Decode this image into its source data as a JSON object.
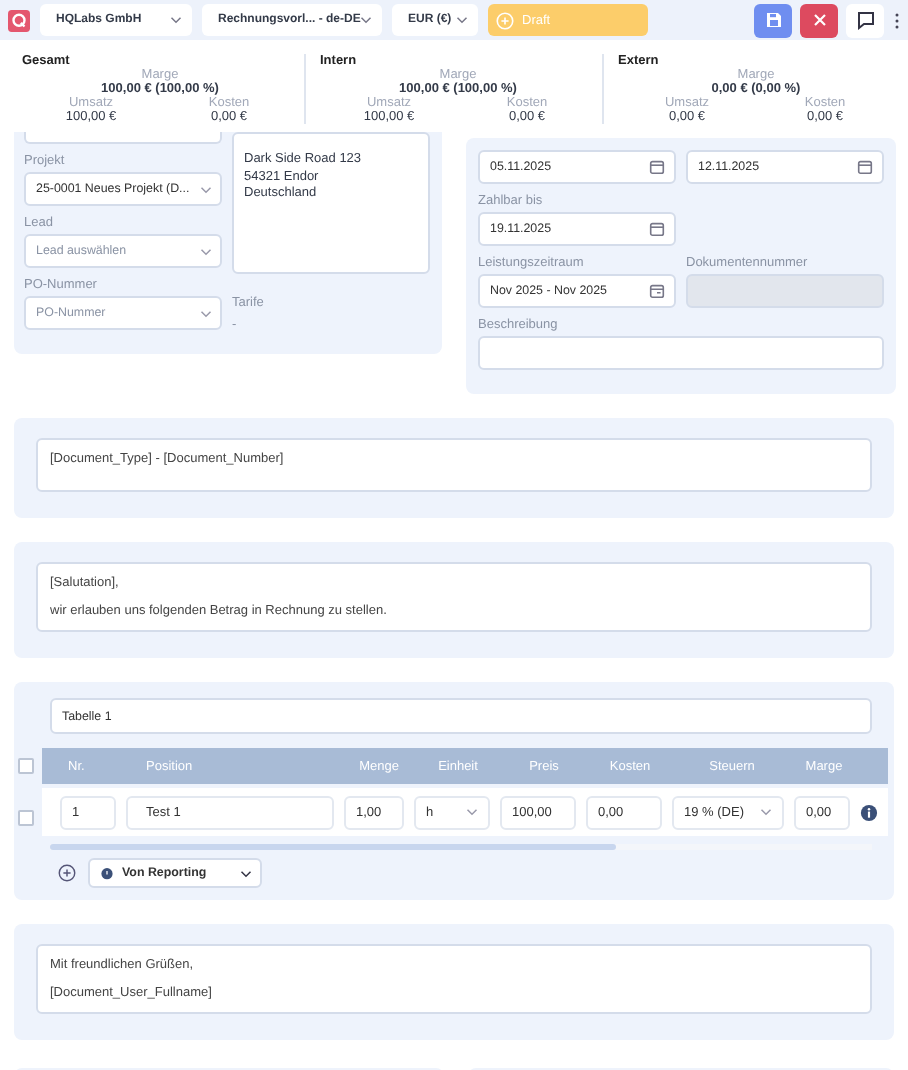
{
  "header": {
    "company": "HQLabs GmbH",
    "template": "Rechnungsvorl... - de-DE",
    "currency": "EUR (€)",
    "status": "Draft"
  },
  "summary": [
    {
      "title": "Gesamt",
      "margin_label": "Marge",
      "margin": "100,00 € (100,00 %)",
      "revenue_label": "Umsatz",
      "revenue": "100,00 €",
      "cost_label": "Kosten",
      "cost": "0,00 €"
    },
    {
      "title": "Intern",
      "margin_label": "Marge",
      "margin": "100,00 € (100,00 %)",
      "revenue_label": "Umsatz",
      "revenue": "100,00 €",
      "cost_label": "Kosten",
      "cost": "0,00 €"
    },
    {
      "title": "Extern",
      "margin_label": "Marge",
      "margin": "0,00 € (0,00 %)",
      "revenue_label": "Umsatz",
      "revenue": "0,00 €",
      "cost_label": "Kosten",
      "cost": "0,00 €"
    }
  ],
  "details": {
    "project_label": "Projekt",
    "project": "25-0001 Neues Projekt (D...",
    "lead_label": "Lead",
    "lead_placeholder": "Lead auswählen",
    "po_label": "PO-Nummer",
    "po_placeholder": "PO-Nummer",
    "address": [
      "Dark Side Road 123",
      "54321 Endor",
      "Deutschland"
    ],
    "tariff_label": "Tarife",
    "tariff": "-",
    "date": "05.11.2025",
    "delivery_date": "12.11.2025",
    "due_label": "Zahlbar bis",
    "due": "19.11.2025",
    "period_label": "Leistungszeitraum",
    "period": "Nov 2025 - Nov 2025",
    "docnum_label": "Dokumentennummer",
    "docnum_disabled": true,
    "description_label": "Beschreibung"
  },
  "document_title": "[Document_Type] - [Document_Number]",
  "intro": [
    "[Salutation],",
    "wir erlauben uns folgenden Betrag in Rechnung zu stellen."
  ],
  "table": {
    "name": "Tabelle 1",
    "header_checked": false,
    "columns": [
      "Nr.",
      "Position",
      "Menge",
      "Einheit",
      "Preis",
      "Kosten",
      "Steuern",
      "Marge"
    ],
    "rows": [
      {
        "checked": false,
        "cells": [
          "1",
          "Test 1",
          "1,00",
          "h",
          "100,00",
          "0,00",
          "19 % (DE)",
          "0,00"
        ]
      }
    ],
    "add_source": "Von Reporting"
  },
  "closing": [
    "Mit freundlichen Grüßen,",
    "[Document_User_Fullname]"
  ]
}
